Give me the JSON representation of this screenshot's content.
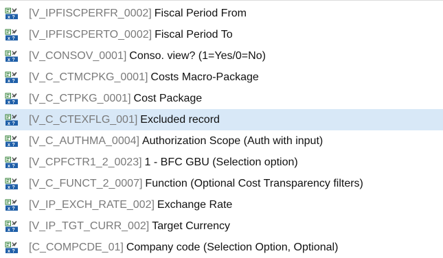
{
  "variables": [
    {
      "tech": "[V_IPFISCPERFR_0002]",
      "desc": "Fiscal Period From",
      "icon": "variable-icon"
    },
    {
      "tech": "[V_IPFISCPERTO_0002]",
      "desc": "Fiscal Period To",
      "icon": "variable-icon"
    },
    {
      "tech": "[V_CONSOV_0001]",
      "desc": "Conso. view? (1=Yes/0=No)",
      "icon": "variable-icon"
    },
    {
      "tech": "[V_C_CTMCPKG_0001]",
      "desc": "Costs Macro-Package",
      "icon": "variable-icon"
    },
    {
      "tech": "[V_C_CTPKG_0001]",
      "desc": "Cost Package",
      "icon": "variable-icon"
    },
    {
      "tech": "[V_C_CTEXFLG_001]",
      "desc": "Excluded record",
      "icon": "variable-icon",
      "selected": true
    },
    {
      "tech": "[V_C_AUTHMA_0004]",
      "desc": "Authorization Scope  (Auth with input)",
      "icon": "variable-icon"
    },
    {
      "tech": "[V_CPFCTR1_2_0023]",
      "desc": "1 - BFC GBU (Selection option)",
      "icon": "variable-icon"
    },
    {
      "tech": "[V_C_FUNCT_2_0007]",
      "desc": "Function (Optional Cost Transparency filters)",
      "icon": "variable-icon"
    },
    {
      "tech": "[V_IP_EXCH_RATE_002]",
      "desc": "Exchange Rate",
      "icon": "variable-icon"
    },
    {
      "tech": "[V_IP_TGT_CURR_002]",
      "desc": "Target Currency",
      "icon": "variable-icon"
    },
    {
      "tech": "[C_COMPCDE_01]",
      "desc": "Company code (Selection Option, Optional)",
      "icon": "variable-icon"
    }
  ],
  "colors": {
    "selection": "#d8e8f7",
    "technical_name": "#7a7a7a",
    "icon_accent": "#2e7d32"
  }
}
